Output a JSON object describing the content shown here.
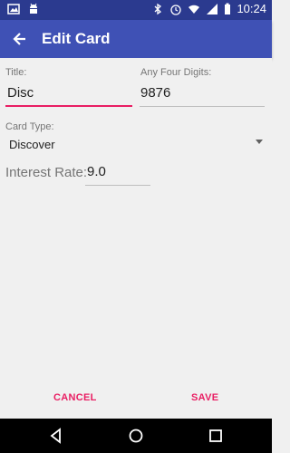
{
  "status_bar": {
    "time": "10:24"
  },
  "app_bar": {
    "title": "Edit Card"
  },
  "form": {
    "title_label": "Title:",
    "title_value": "Disc",
    "digits_label": "Any Four Digits:",
    "digits_value": "9876",
    "card_type_label": "Card Type:",
    "card_type_value": "Discover",
    "interest_label": "Interest Rate:",
    "interest_value": "9.0"
  },
  "actions": {
    "cancel": "CANCEL",
    "save": "SAVE"
  },
  "colors": {
    "primary": "#3f51b5",
    "primary_dark": "#2b3a8f",
    "accent": "#e91e63"
  }
}
